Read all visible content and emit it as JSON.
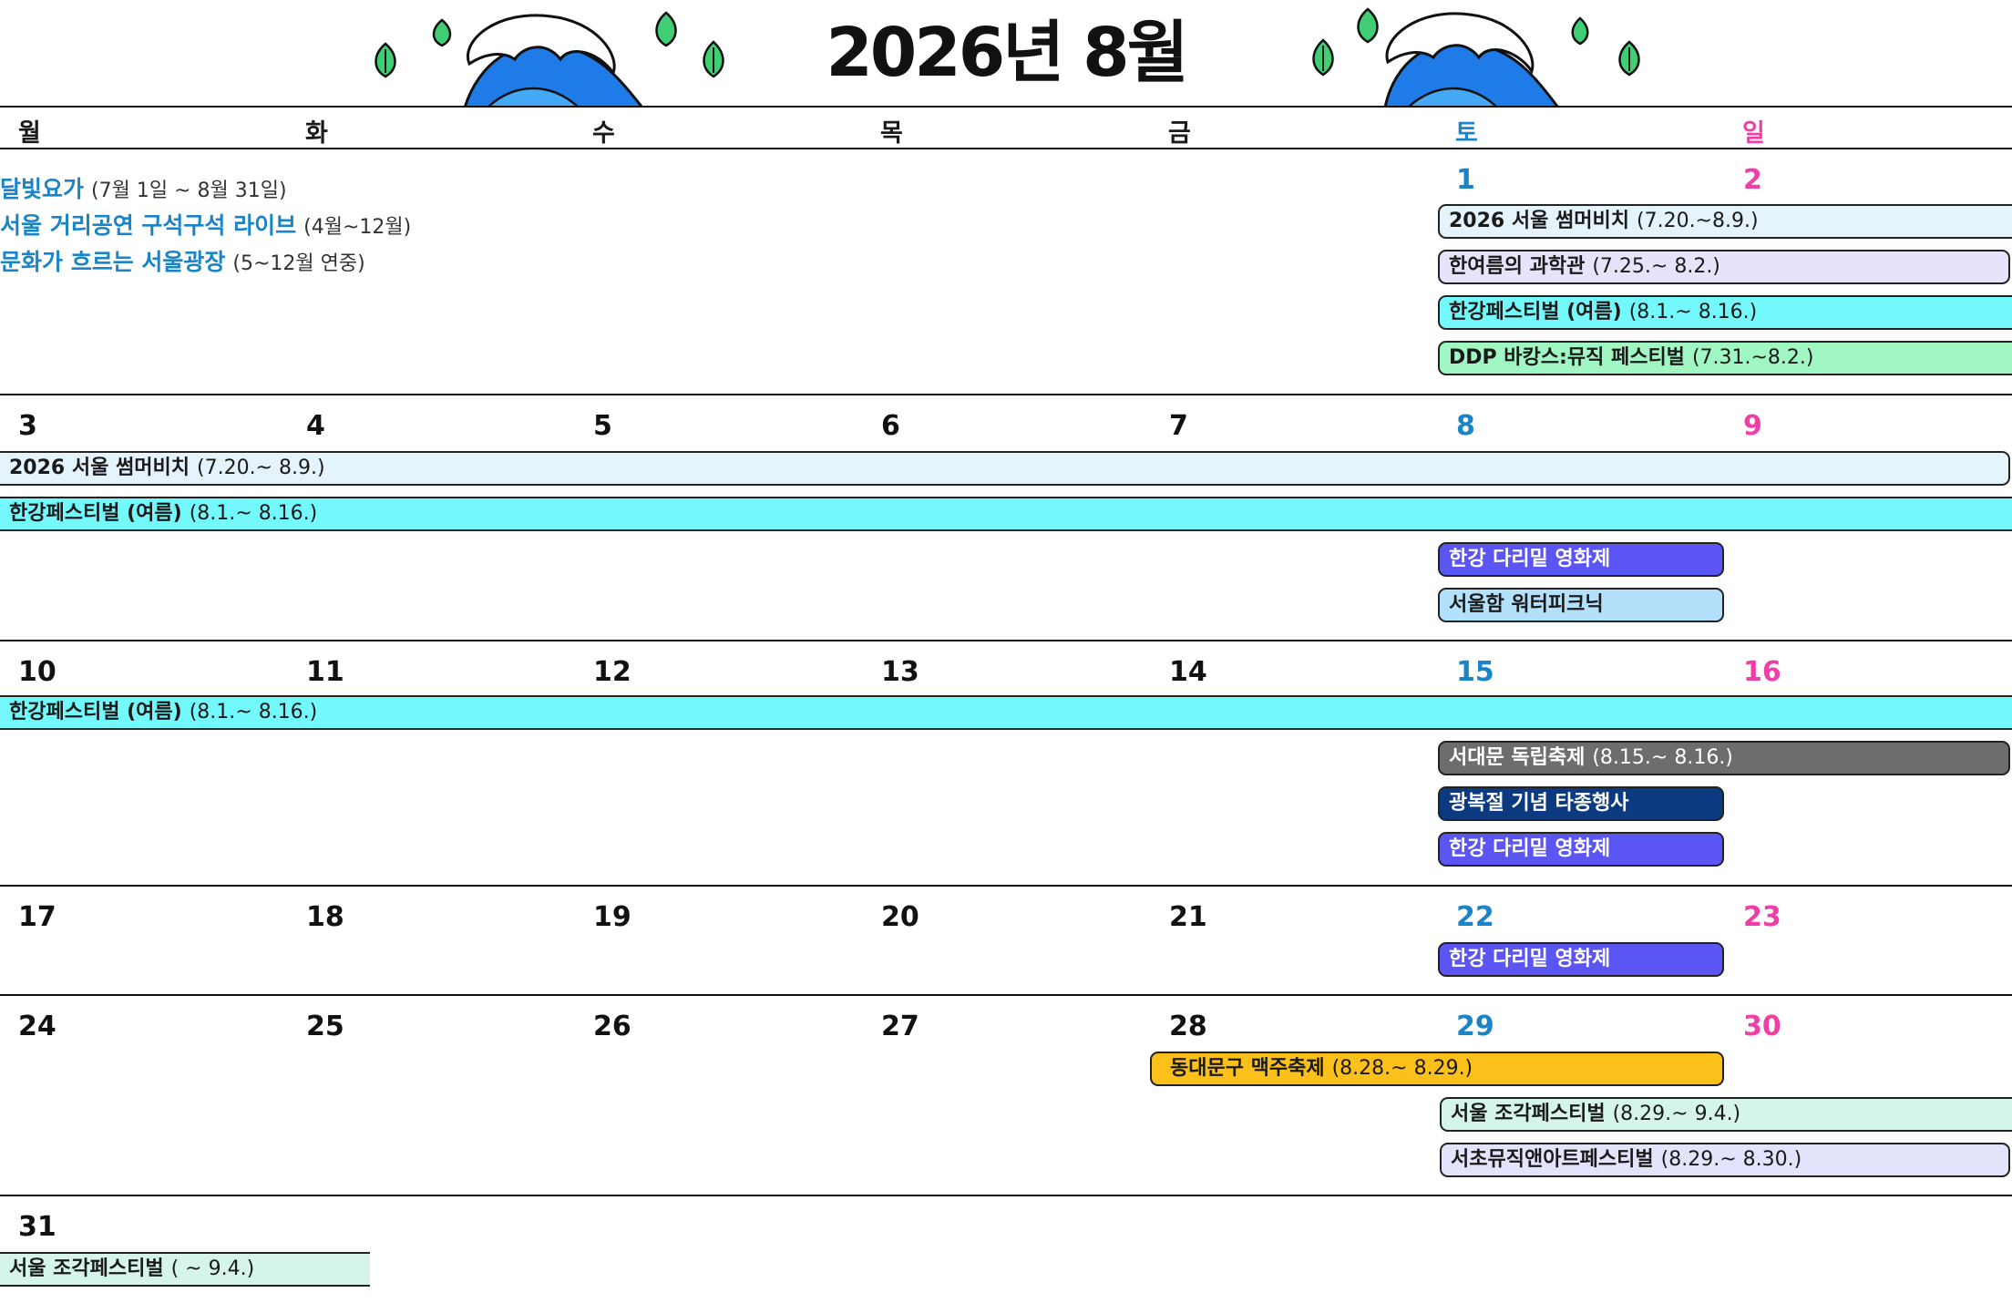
{
  "title": "2026년 8월",
  "colors": {
    "saturday": "#1a84c7",
    "sunday": "#ef3fa7",
    "ongoing_text": "#1a84c7"
  },
  "decorations": [
    "wave-icon",
    "leaf-icon"
  ],
  "weekdays": [
    "월",
    "화",
    "수",
    "목",
    "금",
    "토",
    "일"
  ],
  "ongoing_events": [
    {
      "name": "달빛요가",
      "dates": "(7월 1일 ~ 8월 31일)"
    },
    {
      "name": "서울 거리공연 구석구석 라이브",
      "dates": "(4월~12월)"
    },
    {
      "name": "문화가 흐르는 서울광장",
      "dates": "(5~12월 연중)"
    }
  ],
  "days": {
    "w1": [
      "1",
      "2"
    ],
    "w2": [
      "3",
      "4",
      "5",
      "6",
      "7",
      "8",
      "9"
    ],
    "w3": [
      "10",
      "11",
      "12",
      "13",
      "14",
      "15",
      "16"
    ],
    "w4": [
      "17",
      "18",
      "19",
      "20",
      "21",
      "22",
      "23"
    ],
    "w5": [
      "24",
      "25",
      "26",
      "27",
      "28",
      "29",
      "30"
    ],
    "w6": [
      "31"
    ]
  },
  "events": {
    "w1": [
      {
        "name": "2026 서울 썸머비치",
        "dates": "(7.20.~8.9.)",
        "color": "#e4f3fc"
      },
      {
        "name": "한여름의 과학관",
        "dates": "(7.25.~ 8.2.)",
        "color": "#e8e3fa"
      },
      {
        "name": "한강페스티벌 (여름)",
        "dates": "(8.1.~ 8.16.)",
        "color": "#73f8fb"
      },
      {
        "name": "DDP 바캉스:뮤직 페스티벌",
        "dates": "(7.31.~8.2.)",
        "color": "#a0f7c4"
      }
    ],
    "w2": [
      {
        "name": "2026 서울 썸머비치",
        "dates": "(7.20.~ 8.9.)",
        "color": "#e4f3fc"
      },
      {
        "name": "한강페스티벌 (여름)",
        "dates": "(8.1.~ 8.16.)",
        "color": "#73f8fb"
      },
      {
        "name": "한강 다리밑 영화제",
        "dates": "",
        "color": "#5a55f3"
      },
      {
        "name": "서울함 워터피크닉",
        "dates": "",
        "color": "#b3e0fb"
      }
    ],
    "w3": [
      {
        "name": "한강페스티벌 (여름)",
        "dates": "(8.1.~ 8.16.)",
        "color": "#73f8fb"
      },
      {
        "name": "서대문 독립축제",
        "dates": "(8.15.~ 8.16.)",
        "color": "#6d6d6d"
      },
      {
        "name": "광복절 기념 타종행사",
        "dates": "",
        "color": "#0c3a80"
      },
      {
        "name": "한강 다리밑 영화제",
        "dates": "",
        "color": "#5a55f3"
      }
    ],
    "w4": [
      {
        "name": "한강 다리밑 영화제",
        "dates": "",
        "color": "#5a55f3"
      }
    ],
    "w5": [
      {
        "name": "동대문구 맥주축제",
        "dates": "(8.28.~ 8.29.)",
        "color": "#fcc01b"
      },
      {
        "name": "서울 조각페스티벌",
        "dates": "(8.29.~ 9.4.)",
        "color": "#d5f5ea"
      },
      {
        "name": "서초뮤직앤아트페스티벌",
        "dates": "(8.29.~ 8.30.)",
        "color": "#e3e3fb"
      }
    ],
    "w6": [
      {
        "name": "서울 조각페스티벌",
        "dates": "( ~ 9.4.)",
        "color": "#d5f5ea"
      }
    ]
  }
}
